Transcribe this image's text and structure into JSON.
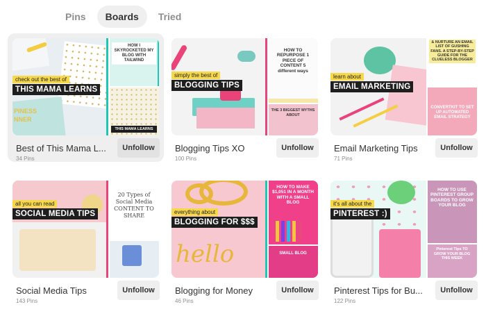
{
  "tabs": [
    {
      "label": "Pins",
      "active": false
    },
    {
      "label": "Boards",
      "active": true
    },
    {
      "label": "Tried",
      "active": false
    }
  ],
  "unfollow_label": "Unfollow",
  "boards": [
    {
      "title": "Best of This Mama L...",
      "count": "34 Pins",
      "cover_small": "check out the best of",
      "cover_big": "THIS MAMA LEARNS",
      "side_top": "HOW I SKYROCKETED MY BLOG WITH TAILWIND",
      "side_bottom": "THIS MAMA LEARNS",
      "cover_extra": "PINESS NNER"
    },
    {
      "title": "Blogging Tips XO",
      "count": "100 Pins",
      "cover_small": "simply the best of",
      "cover_big": "BLOGGING TIPS",
      "side_top": "HOW TO REPURPOSE 1 PIECE OF CONTENT 5 different ways",
      "side_bottom": "THE 3 BIGGEST MYTHS ABOUT"
    },
    {
      "title": "Email Marketing Tips",
      "count": "71 Pins",
      "cover_small": "learn about",
      "cover_big": "EMAIL MARKETING",
      "side_top": "& NURTURE AN EMAIL LIST OF GUSHING FANS. A STEP-BY-STEP GUIDE FOR THE CLUELESS BLOGGER",
      "side_bottom": "CONVERTKIT TO SET UP AUTOMATED EMAIL STRATEGY"
    },
    {
      "title": "Social Media Tips",
      "count": "143 Pins",
      "cover_small": "all you can read",
      "cover_big": "SOCIAL MEDIA TIPS",
      "side_top": "20 Types of Social Media CONTENT TO SHARE",
      "side_bottom": ""
    },
    {
      "title": "Blogging for Money",
      "count": "46 Pins",
      "cover_small": "everything about",
      "cover_big": "BLOGGING FOR $$$",
      "side_top": "HOW TO MAKE $1,051 IN A MONTH WITH A SMALL BLOG",
      "side_bottom": "SMALL BLOG",
      "cover_extra": "hello"
    },
    {
      "title": "Pinterest Tips for Bu...",
      "count": "122 Pins",
      "cover_small": "it's all about the",
      "cover_big": "PINTEREST :)",
      "side_top": "HOW TO USE PINTEREST GROUP BOARDS TO GROW YOUR BLOG",
      "side_bottom": "Pinterest Tips TO GROW YOUR BLOG THIS WEEK"
    }
  ],
  "colors": {
    "tab_active_bg": "#efefef",
    "button_bg": "#efefef",
    "teal": "#1ec6b6",
    "pink": "#e8447a",
    "yellow": "#f7d84b"
  }
}
